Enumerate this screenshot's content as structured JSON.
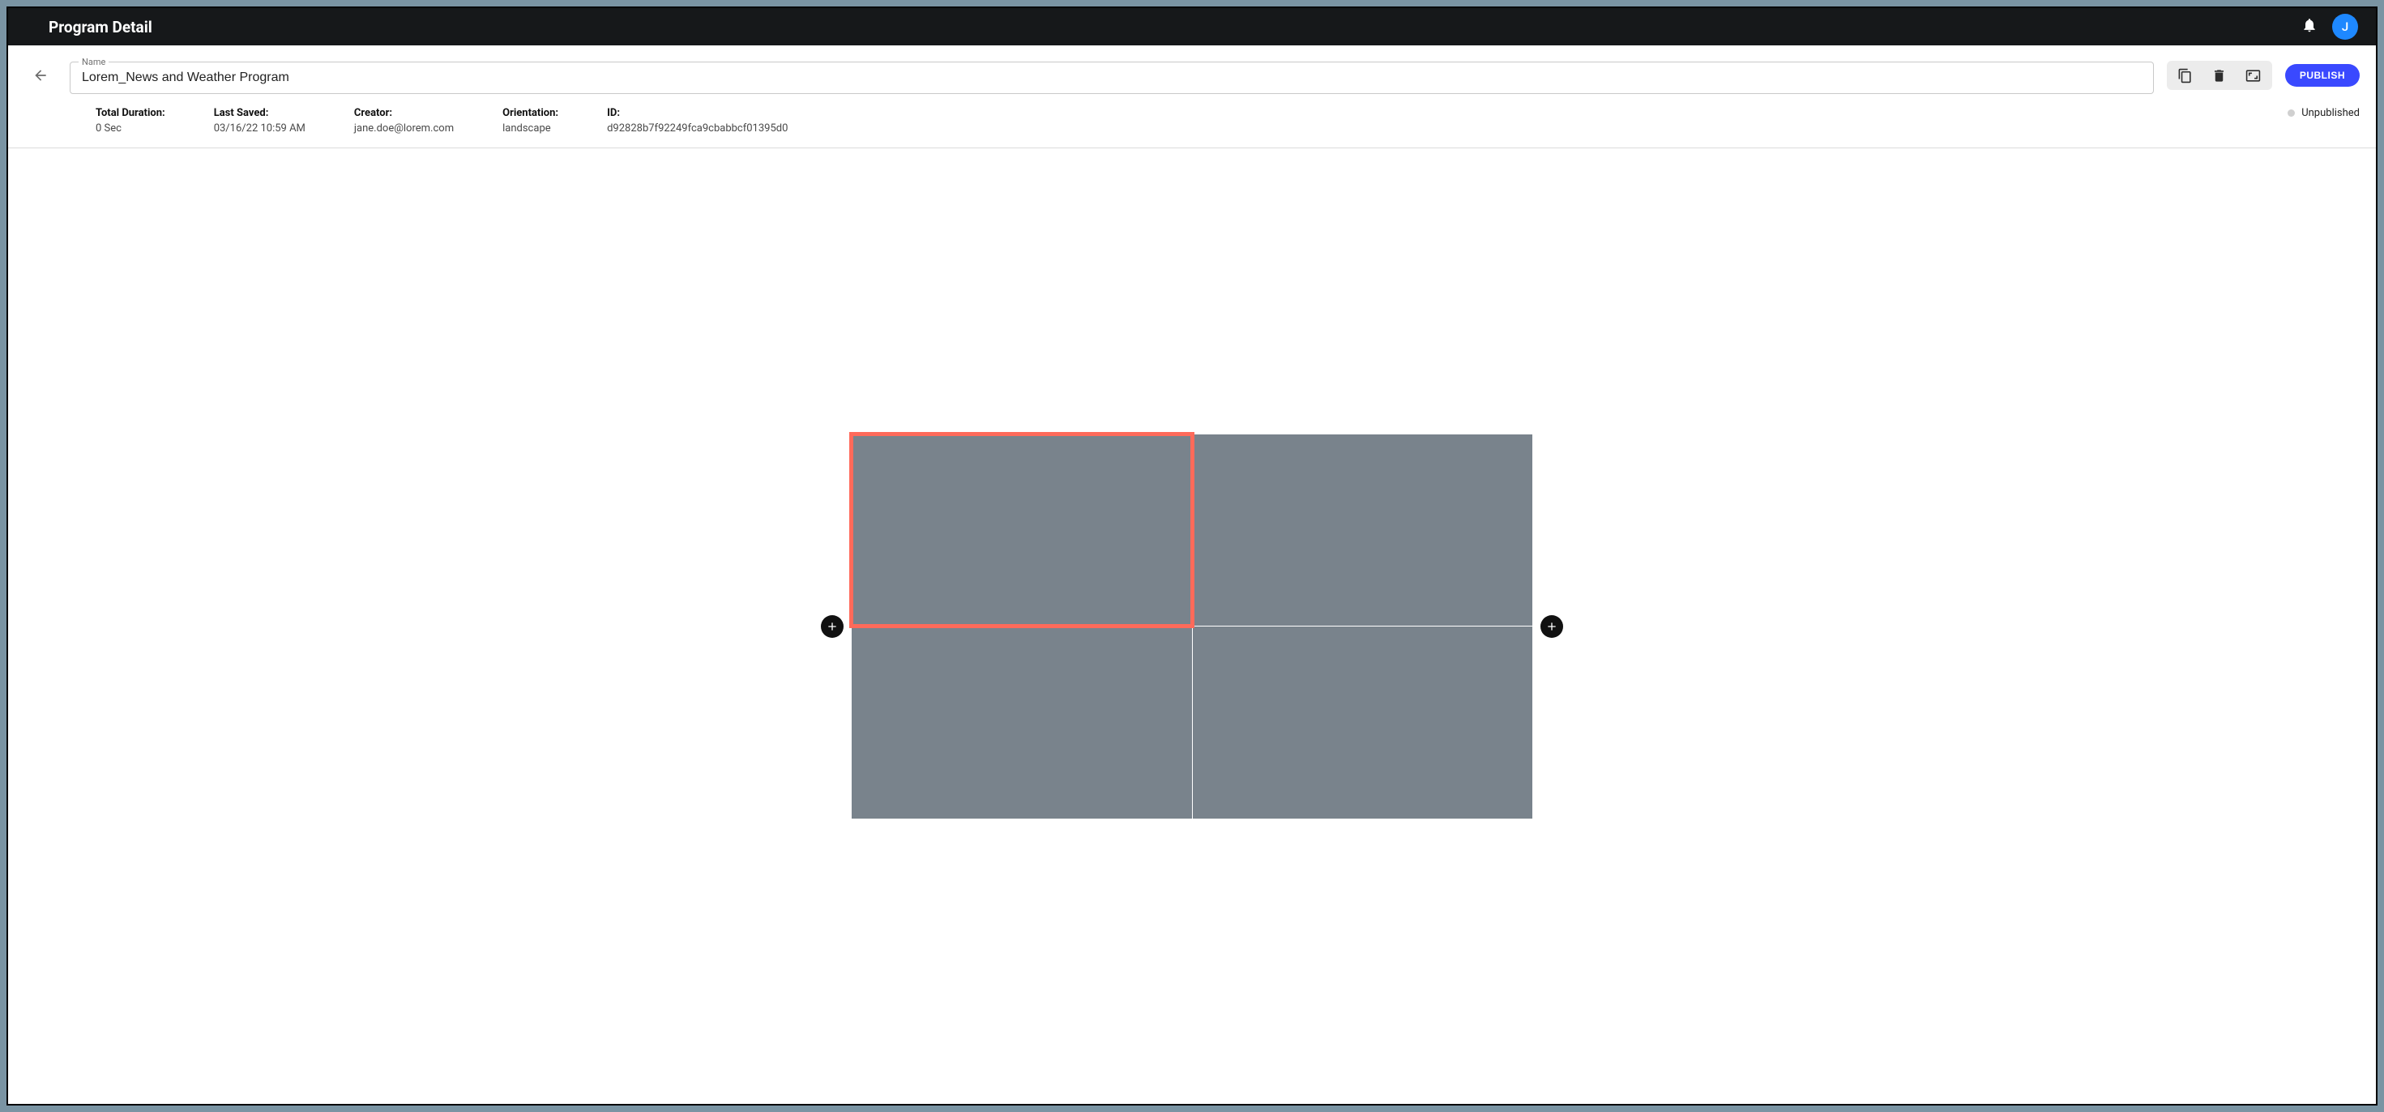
{
  "header": {
    "title": "Program Detail",
    "avatar_initial": "J"
  },
  "name_field": {
    "label": "Name",
    "value": "Lorem_News and Weather Program"
  },
  "actions": {
    "publish_label": "PUBLISH"
  },
  "meta": {
    "total_duration": {
      "label": "Total Duration:",
      "value": "0 Sec"
    },
    "last_saved": {
      "label": "Last Saved:",
      "value": "03/16/22 10:59 AM"
    },
    "creator": {
      "label": "Creator:",
      "value": "jane.doe@lorem.com"
    },
    "orientation": {
      "label": "Orientation:",
      "value": "landscape"
    },
    "id": {
      "label": "ID:",
      "value": "d92828b7f92249fca9cbabbcf01395d0"
    }
  },
  "status": {
    "text": "Unpublished"
  },
  "grid": {
    "rows": 2,
    "cols": 2,
    "selected_index": 0
  }
}
